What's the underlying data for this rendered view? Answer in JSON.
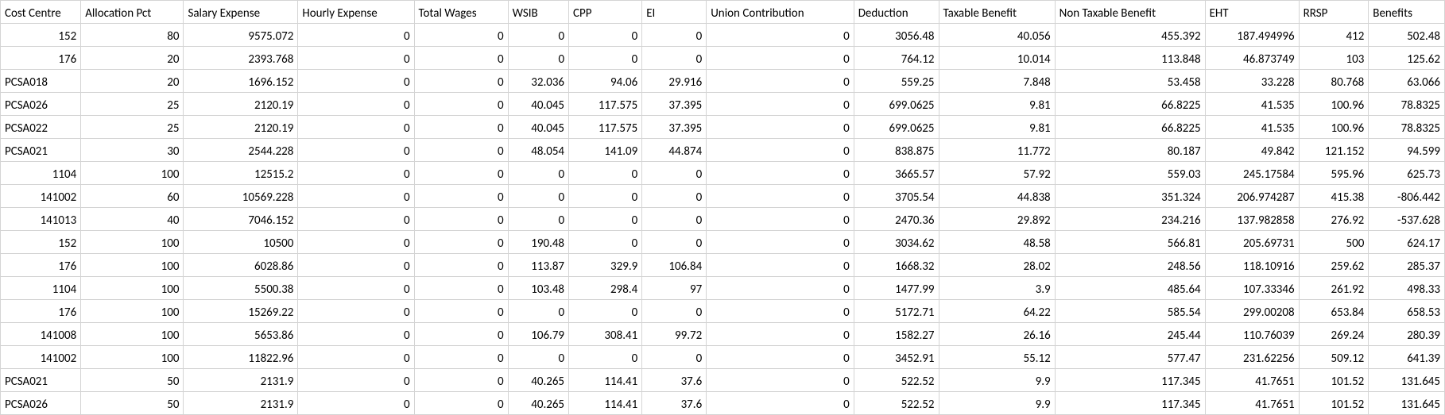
{
  "table": {
    "headers": [
      "Cost Centre",
      "Allocation Pct",
      "Salary Expense",
      "Hourly Expense",
      "Total Wages",
      "WSIB",
      "CPP",
      "EI",
      "Union Contribution",
      "Deduction",
      "Taxable Benefit",
      "Non Taxable Benefit",
      "EHT",
      "RRSP",
      "Benefits"
    ],
    "textColumns": [
      0
    ],
    "rows": [
      [
        "152",
        "80",
        "9575.072",
        "0",
        "0",
        "0",
        "0",
        "0",
        "0",
        "3056.48",
        "40.056",
        "455.392",
        "187.494996",
        "412",
        "502.48"
      ],
      [
        "176",
        "20",
        "2393.768",
        "0",
        "0",
        "0",
        "0",
        "0",
        "0",
        "764.12",
        "10.014",
        "113.848",
        "46.873749",
        "103",
        "125.62"
      ],
      [
        "PCSA018",
        "20",
        "1696.152",
        "0",
        "0",
        "32.036",
        "94.06",
        "29.916",
        "0",
        "559.25",
        "7.848",
        "53.458",
        "33.228",
        "80.768",
        "63.066"
      ],
      [
        "PCSA026",
        "25",
        "2120.19",
        "0",
        "0",
        "40.045",
        "117.575",
        "37.395",
        "0",
        "699.0625",
        "9.81",
        "66.8225",
        "41.535",
        "100.96",
        "78.8325"
      ],
      [
        "PCSA022",
        "25",
        "2120.19",
        "0",
        "0",
        "40.045",
        "117.575",
        "37.395",
        "0",
        "699.0625",
        "9.81",
        "66.8225",
        "41.535",
        "100.96",
        "78.8325"
      ],
      [
        "PCSA021",
        "30",
        "2544.228",
        "0",
        "0",
        "48.054",
        "141.09",
        "44.874",
        "0",
        "838.875",
        "11.772",
        "80.187",
        "49.842",
        "121.152",
        "94.599"
      ],
      [
        "1104",
        "100",
        "12515.2",
        "0",
        "0",
        "0",
        "0",
        "0",
        "0",
        "3665.57",
        "57.92",
        "559.03",
        "245.17584",
        "595.96",
        "625.73"
      ],
      [
        "141002",
        "60",
        "10569.228",
        "0",
        "0",
        "0",
        "0",
        "0",
        "0",
        "3705.54",
        "44.838",
        "351.324",
        "206.974287",
        "415.38",
        "-806.442"
      ],
      [
        "141013",
        "40",
        "7046.152",
        "0",
        "0",
        "0",
        "0",
        "0",
        "0",
        "2470.36",
        "29.892",
        "234.216",
        "137.982858",
        "276.92",
        "-537.628"
      ],
      [
        "152",
        "100",
        "10500",
        "0",
        "0",
        "190.48",
        "0",
        "0",
        "0",
        "3034.62",
        "48.58",
        "566.81",
        "205.69731",
        "500",
        "624.17"
      ],
      [
        "176",
        "100",
        "6028.86",
        "0",
        "0",
        "113.87",
        "329.9",
        "106.84",
        "0",
        "1668.32",
        "28.02",
        "248.56",
        "118.10916",
        "259.62",
        "285.37"
      ],
      [
        "1104",
        "100",
        "5500.38",
        "0",
        "0",
        "103.48",
        "298.4",
        "97",
        "0",
        "1477.99",
        "3.9",
        "485.64",
        "107.33346",
        "261.92",
        "498.33"
      ],
      [
        "176",
        "100",
        "15269.22",
        "0",
        "0",
        "0",
        "0",
        "0",
        "0",
        "5172.71",
        "64.22",
        "585.54",
        "299.00208",
        "653.84",
        "658.53"
      ],
      [
        "141008",
        "100",
        "5653.86",
        "0",
        "0",
        "106.79",
        "308.41",
        "99.72",
        "0",
        "1582.27",
        "26.16",
        "245.44",
        "110.76039",
        "269.24",
        "280.39"
      ],
      [
        "141002",
        "100",
        "11822.96",
        "0",
        "0",
        "0",
        "0",
        "0",
        "0",
        "3452.91",
        "55.12",
        "577.47",
        "231.62256",
        "509.12",
        "641.39"
      ],
      [
        "PCSA021",
        "50",
        "2131.9",
        "0",
        "0",
        "40.265",
        "114.41",
        "37.6",
        "0",
        "522.52",
        "9.9",
        "117.345",
        "41.7651",
        "101.52",
        "131.645"
      ],
      [
        "PCSA026",
        "50",
        "2131.9",
        "0",
        "0",
        "40.265",
        "114.41",
        "37.6",
        "0",
        "522.52",
        "9.9",
        "117.345",
        "41.7651",
        "101.52",
        "131.645"
      ]
    ]
  }
}
